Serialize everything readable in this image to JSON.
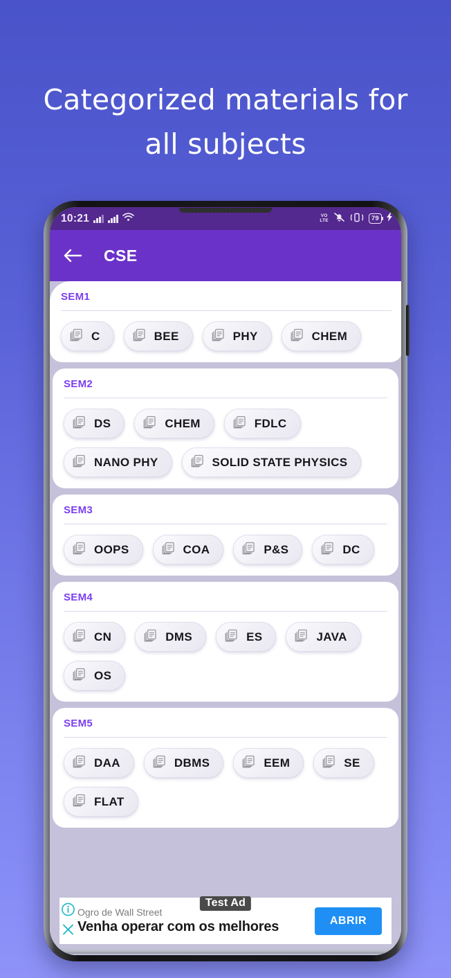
{
  "promo": {
    "headline_line1": "Categorized materials for",
    "headline_line2": "all subjects"
  },
  "statusbar": {
    "clock": "10:21",
    "volte_top": "VO",
    "volte_bottom": "LTE",
    "battery_percent": "79",
    "icons": [
      "signal-bars-1",
      "signal-bars-2",
      "wifi",
      "volte",
      "mute",
      "vibrate",
      "battery",
      "charging-bolt"
    ]
  },
  "appbar": {
    "back_label": "Back",
    "title": "CSE"
  },
  "semesters": [
    {
      "title": "SEM1",
      "subjects": [
        "C",
        "BEE",
        "PHY",
        "CHEM"
      ]
    },
    {
      "title": "SEM2",
      "subjects": [
        "DS",
        "CHEM",
        "FDLC",
        "NANO PHY",
        "SOLID STATE PHYSICS"
      ]
    },
    {
      "title": "SEM3",
      "subjects": [
        "OOPS",
        "COA",
        "P&S",
        "DC"
      ]
    },
    {
      "title": "SEM4",
      "subjects": [
        "CN",
        "DMS",
        "ES",
        "JAVA",
        "OS"
      ]
    },
    {
      "title": "SEM5",
      "subjects": [
        "DAA",
        "DBMS",
        "EEM",
        "SE",
        "FLAT"
      ]
    }
  ],
  "ad": {
    "advertiser": "Ogro de Wall Street",
    "headline": "Venha operar com os melhores",
    "badge": "Test Ad",
    "cta": "ABRIR",
    "info_icon": "info-icon",
    "close_icon": "close-icon"
  },
  "colors": {
    "background_top": "#4a53c9",
    "background_bottom": "#8e93f8",
    "appbar": "#6b32c9",
    "statusbar": "#53288f",
    "sem_title": "#7c3ff0",
    "page_bg": "#c5c1da",
    "cta": "#1f8ff5",
    "ad_accent": "#20b6c9"
  }
}
